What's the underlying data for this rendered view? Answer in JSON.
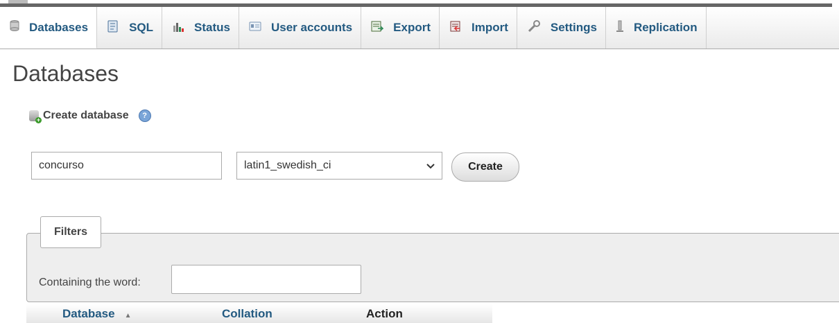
{
  "tabs": [
    {
      "label": "Databases",
      "icon": "database-icon"
    },
    {
      "label": "SQL",
      "icon": "sql-icon"
    },
    {
      "label": "Status",
      "icon": "status-icon"
    },
    {
      "label": "User accounts",
      "icon": "user-accounts-icon"
    },
    {
      "label": "Export",
      "icon": "export-icon"
    },
    {
      "label": "Import",
      "icon": "import-icon"
    },
    {
      "label": "Settings",
      "icon": "settings-icon"
    },
    {
      "label": "Replication",
      "icon": "replication-icon"
    }
  ],
  "page": {
    "title": "Databases"
  },
  "create": {
    "title": "Create database",
    "name_value": "concurso",
    "collation_value": "latin1_swedish_ci",
    "button": "Create"
  },
  "filters": {
    "legend": "Filters",
    "containing_label": "Containing the word:",
    "containing_value": ""
  },
  "table": {
    "headers": {
      "database": "Database",
      "collation": "Collation",
      "action": "Action"
    }
  }
}
